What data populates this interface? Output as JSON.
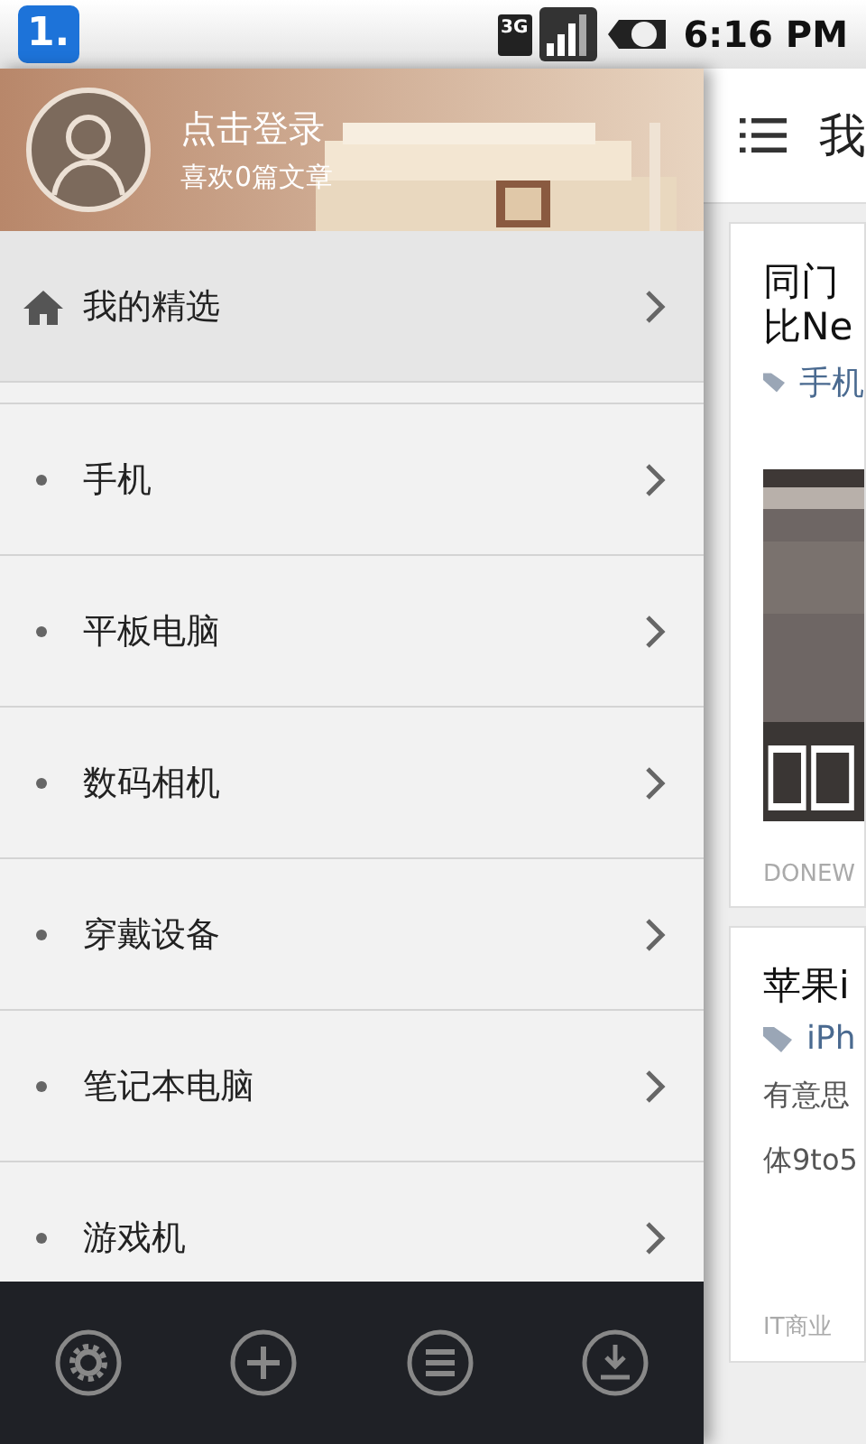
{
  "status_bar": {
    "app_badge": "1.",
    "network": "3G",
    "time": "6:16 PM"
  },
  "drawer": {
    "header": {
      "kind": "picture",
      "login": "点击登录",
      "likes": "喜欢0篇文章"
    },
    "featured": {
      "label": "我的精选",
      "selected": true
    },
    "categories": [
      {
        "label": "手机"
      },
      {
        "label": "平板电脑"
      },
      {
        "label": "数码相机"
      },
      {
        "label": "穿戴设备"
      },
      {
        "label": "笔记本电脑"
      },
      {
        "label": "游戏机"
      }
    ],
    "toolbar": [
      {
        "kind": "settings"
      },
      {
        "kind": "add"
      },
      {
        "kind": "list"
      },
      {
        "kind": "download"
      }
    ]
  },
  "main": {
    "title": "我",
    "articles": [
      {
        "title_lines": [
          "同门",
          "比Ne"
        ],
        "tag": "手机",
        "source": "DONEW"
      },
      {
        "title_lines": [
          "苹果i"
        ],
        "tag": "iPh",
        "kind": "text",
        "excerpt_lines": [
          "有意思",
          "体9to5"
        ],
        "source": "IT商业"
      }
    ]
  }
}
